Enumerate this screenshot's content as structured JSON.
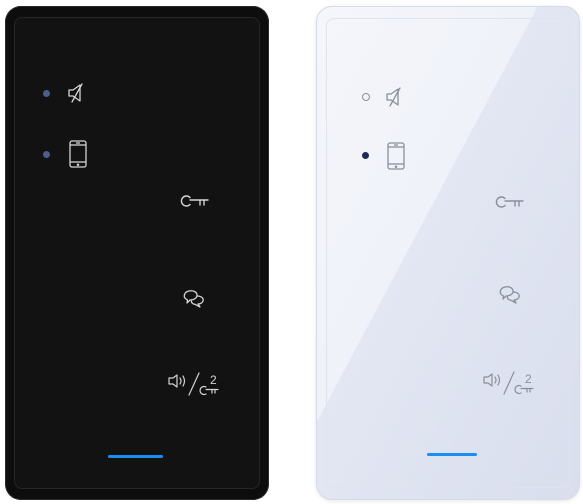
{
  "variants": [
    {
      "finish": "black",
      "indicators": [
        {
          "icon": "speaker-muted-icon",
          "led_state": "on"
        },
        {
          "icon": "smartphone-icon",
          "led_state": "on"
        }
      ],
      "buttons": [
        {
          "icon": "key-icon"
        },
        {
          "icon": "chat-bubbles-icon"
        },
        {
          "icon": "speaker-key-icon",
          "label": "2"
        }
      ],
      "status_color": "#1a8df0"
    },
    {
      "finish": "white",
      "indicators": [
        {
          "icon": "speaker-muted-icon",
          "led_state": "off"
        },
        {
          "icon": "smartphone-icon",
          "led_state": "on"
        }
      ],
      "buttons": [
        {
          "icon": "key-icon"
        },
        {
          "icon": "chat-bubbles-icon"
        },
        {
          "icon": "speaker-key-icon",
          "label": "2"
        }
      ],
      "status_color": "#1c8ef2"
    }
  ]
}
